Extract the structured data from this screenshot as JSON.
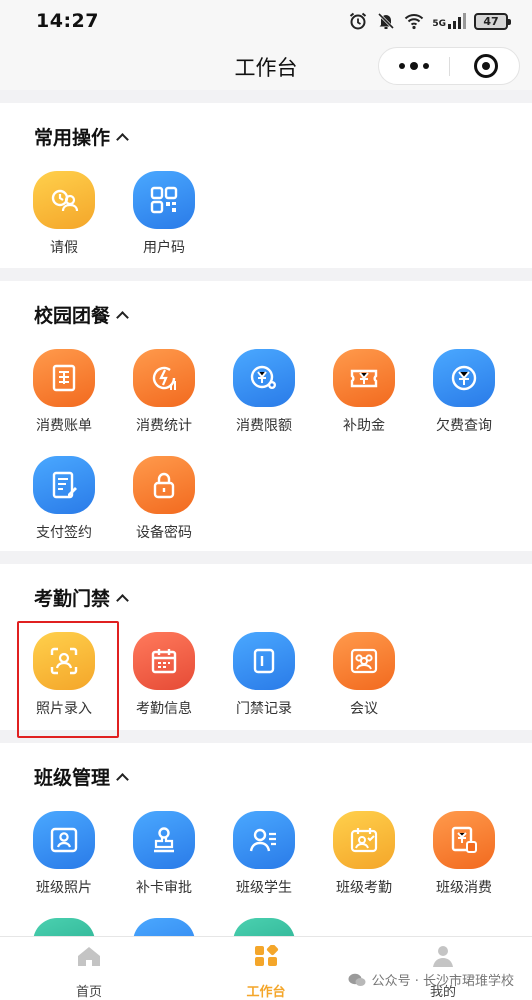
{
  "status": {
    "time": "14:27",
    "network": "5G",
    "battery": "47"
  },
  "nav": {
    "title": "工作台"
  },
  "sections": [
    {
      "title": "常用操作",
      "items": [
        {
          "label": "请假",
          "icon": "leave-icon",
          "color": "#f4a62a"
        },
        {
          "label": "用户码",
          "icon": "qr-code-icon",
          "color": "#2a7be8"
        }
      ]
    },
    {
      "title": "校园团餐",
      "items": [
        {
          "label": "消费账单",
          "icon": "bill-icon",
          "color": "#f26a1f"
        },
        {
          "label": "消费统计",
          "icon": "stats-icon",
          "color": "#f26a1f"
        },
        {
          "label": "消费限额",
          "icon": "limit-icon",
          "color": "#2a7be8"
        },
        {
          "label": "补助金",
          "icon": "subsidy-icon",
          "color": "#f26a1f"
        },
        {
          "label": "欠费查询",
          "icon": "arrears-icon",
          "color": "#2a7be8"
        },
        {
          "label": "支付签约",
          "icon": "payment-sign-icon",
          "color": "#2a7be8"
        },
        {
          "label": "设备密码",
          "icon": "lock-icon",
          "color": "#f26a1f"
        }
      ]
    },
    {
      "title": "考勤门禁",
      "items": [
        {
          "label": "照片录入",
          "icon": "face-scan-icon",
          "color": "#f4a62a"
        },
        {
          "label": "考勤信息",
          "icon": "calendar-icon",
          "color": "#e64b36"
        },
        {
          "label": "门禁记录",
          "icon": "door-icon",
          "color": "#2a7be8"
        },
        {
          "label": "会议",
          "icon": "meeting-icon",
          "color": "#f26a1f"
        }
      ]
    },
    {
      "title": "班级管理",
      "items": [
        {
          "label": "班级照片",
          "icon": "class-photo-icon",
          "color": "#2a7be8"
        },
        {
          "label": "补卡审批",
          "icon": "approval-stamp-icon",
          "color": "#2a7be8"
        },
        {
          "label": "班级学生",
          "icon": "students-icon",
          "color": "#2a7be8"
        },
        {
          "label": "班级考勤",
          "icon": "class-attendance-icon",
          "color": "#f4a62a"
        },
        {
          "label": "班级消费",
          "icon": "class-consume-icon",
          "color": "#f26a1f"
        }
      ]
    }
  ],
  "tabs": [
    {
      "label": "首页",
      "icon": "home-icon"
    },
    {
      "label": "工作台",
      "icon": "workbench-icon",
      "active": true
    },
    {
      "label": "我的",
      "icon": "profile-icon"
    }
  ],
  "watermark": "公众号 · 长沙市珺琟学校"
}
